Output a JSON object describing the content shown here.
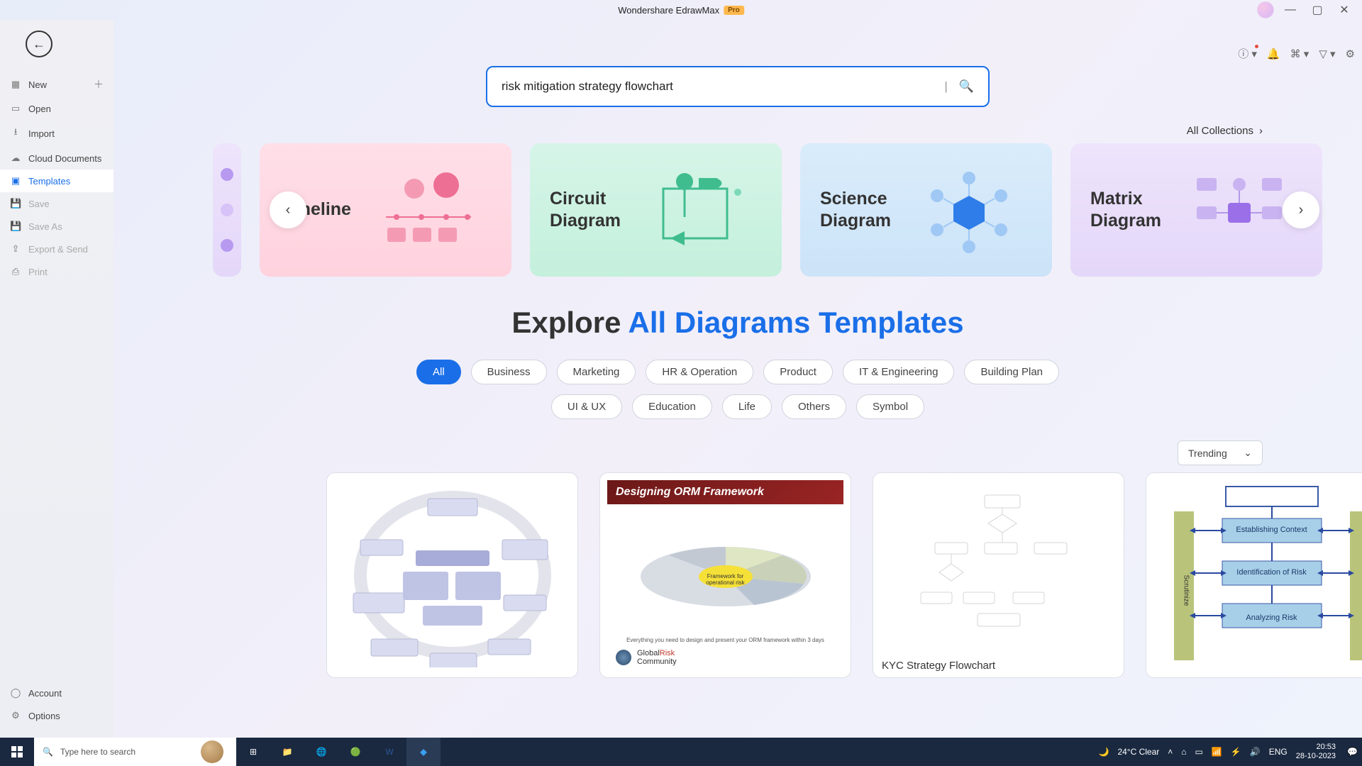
{
  "titlebar": {
    "app_name": "Wondershare EdrawMax",
    "pro": "Pro"
  },
  "sidebar": {
    "new": "New",
    "open": "Open",
    "import": "Import",
    "cloud": "Cloud Documents",
    "templates": "Templates",
    "save": "Save",
    "saveas": "Save As",
    "export": "Export & Send",
    "print": "Print",
    "account": "Account",
    "options": "Options"
  },
  "search": {
    "value": "risk mitigation strategy flowchart"
  },
  "all_collections": "All Collections",
  "cards": {
    "timeline": "Timeline",
    "circuit": "Circuit\nDiagram",
    "science": "Science\nDiagram",
    "matrix": "Matrix\nDiagram"
  },
  "explore": {
    "prefix": "Explore ",
    "highlight": "All Diagrams Templates"
  },
  "chips": [
    "All",
    "Business",
    "Marketing",
    "HR & Operation",
    "Product",
    "IT & Engineering",
    "Building Plan"
  ],
  "chips2": [
    "UI & UX",
    "Education",
    "Life",
    "Others",
    "Symbol"
  ],
  "sort": "Trending",
  "templates": {
    "t3_label": "KYC Strategy Flowchart",
    "orm_title": "Designing ORM Framework",
    "orm_center": "Framework for operational risk",
    "orm_sub": "Everything you need to design and present your ORM framework within 3 days",
    "orm_brand1": "Global",
    "orm_brand2": "Risk",
    "orm_brand3": "Community",
    "rm_b1": "Establishing Context",
    "rm_b2": "Identification of Risk",
    "rm_b3": "Analyzing Risk",
    "rm_side": "Scrutinize"
  },
  "taskbar": {
    "search_placeholder": "Type here to search",
    "weather": "24°C  Clear",
    "lang": "ENG",
    "time": "20:53",
    "date": "28-10-2023"
  }
}
